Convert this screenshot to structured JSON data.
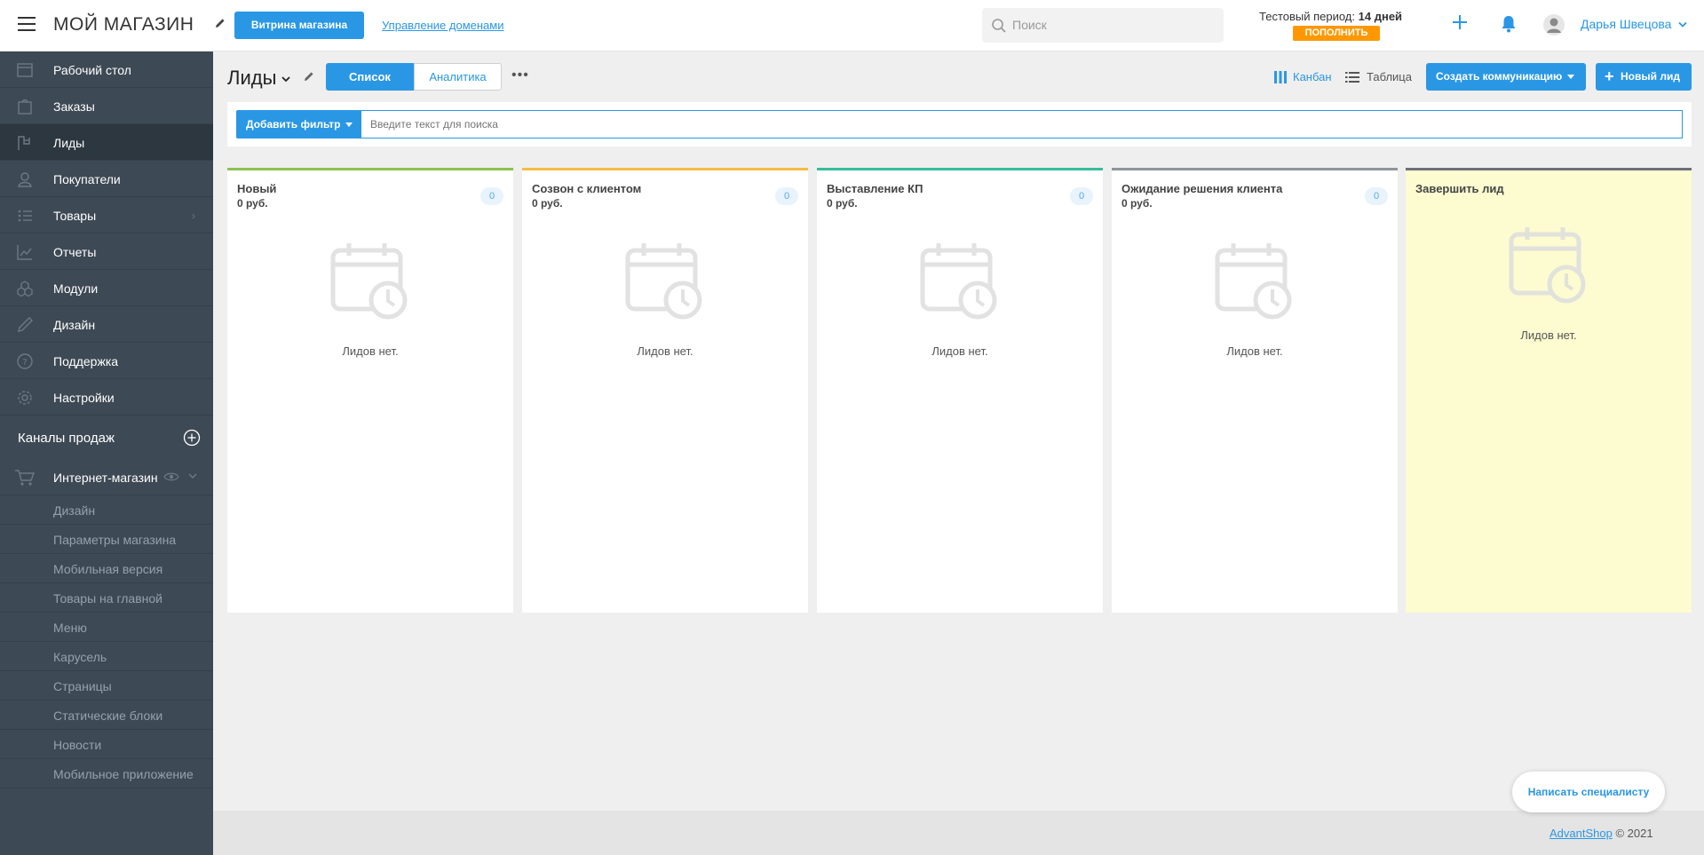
{
  "header": {
    "store_title": "МОЙ МАГАЗИН",
    "showcase_button": "Витрина магазина",
    "domains_link": "Управление доменами",
    "search_placeholder": "Поиск",
    "trial_label": "Тестовый период:",
    "trial_days": "14 дней",
    "topup_button": "ПОПОЛНИТЬ",
    "user_name": "Дарья Швецова"
  },
  "sidebar": {
    "items": [
      {
        "label": "Рабочий стол",
        "icon": "desktop-icon"
      },
      {
        "label": "Заказы",
        "icon": "orders-icon"
      },
      {
        "label": "Лиды",
        "icon": "leads-icon",
        "active": true
      },
      {
        "label": "Покупатели",
        "icon": "customers-icon"
      },
      {
        "label": "Товары",
        "icon": "products-icon",
        "has_arrow": true
      },
      {
        "label": "Отчеты",
        "icon": "reports-icon"
      },
      {
        "label": "Модули",
        "icon": "modules-icon"
      },
      {
        "label": "Дизайн",
        "icon": "design-icon"
      },
      {
        "label": "Поддержка",
        "icon": "support-icon"
      },
      {
        "label": "Настройки",
        "icon": "settings-icon"
      }
    ],
    "channels_label": "Каналы продаж",
    "shop_label": "Интернет-магазин",
    "shop_subitems": [
      "Дизайн",
      "Параметры магазина",
      "Мобильная версия",
      "Товары на главной",
      "Меню",
      "Карусель",
      "Страницы",
      "Статические блоки",
      "Новости",
      "Мобильное приложение"
    ]
  },
  "toolbar": {
    "page_title": "Лиды",
    "tab_list": "Список",
    "tab_analytics": "Аналитика",
    "more": "•••",
    "view_kanban": "Канбан",
    "view_table": "Таблица",
    "create_comm_button": "Создать коммуникацию",
    "new_lead_button": "Новый лид"
  },
  "filter": {
    "add_filter_button": "Добавить фильтр",
    "search_placeholder": "Введите текст для поиска"
  },
  "kanban": {
    "columns": [
      {
        "name": "Новый",
        "sum": "0 руб.",
        "count": "0",
        "empty_text": "Лидов нет.",
        "color": "#8cc152"
      },
      {
        "name": "Созвон с клиентом",
        "sum": "0 руб.",
        "count": "0",
        "empty_text": "Лидов нет.",
        "color": "#f6bb42"
      },
      {
        "name": "Выставление КП",
        "sum": "0 руб.",
        "count": "0",
        "empty_text": "Лидов нет.",
        "color": "#37bc9b"
      },
      {
        "name": "Ожидание решения клиента",
        "sum": "0 руб.",
        "count": "0",
        "empty_text": "Лидов нет.",
        "color": "#8d959c"
      },
      {
        "name": "Завершить лид",
        "empty_text": "Лидов нет.",
        "color": "#6d7178"
      }
    ]
  },
  "footer": {
    "brand_link": "AdvantShop",
    "copyright": "© 2021",
    "specialist_button": "Написать специалисту"
  },
  "colors": {
    "accent": "#2a97e5",
    "sidebar_bg": "#3d4954",
    "topup": "#ff9800"
  }
}
